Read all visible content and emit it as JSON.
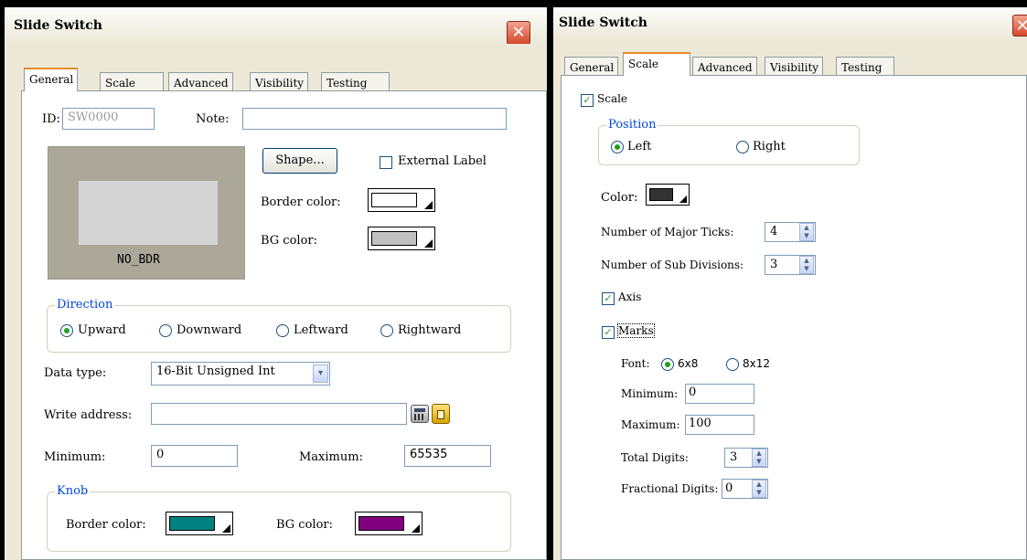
{
  "left": {
    "title": "Slide Switch",
    "tabs": [
      "General",
      "Scale",
      "Advanced",
      "Visibility",
      "Testing"
    ],
    "id_label": "ID:",
    "id_value": "SW0000",
    "note_label": "Note:",
    "note_value": "",
    "preview_label": "NO_BDR",
    "shape_button": "Shape...",
    "external_label": "External Label",
    "border_color_label": "Border color:",
    "bg_color_label": "BG color:",
    "direction_caption": "Direction",
    "directions": [
      "Upward",
      "Downward",
      "Leftward",
      "Rightward"
    ],
    "direction_selected": "Upward",
    "data_type_label": "Data type:",
    "data_type_value": "16-Bit Unsigned Int",
    "write_address_label": "Write address:",
    "write_address_value": "",
    "minimum_label": "Minimum:",
    "minimum_value": "0",
    "maximum_label": "Maximum:",
    "maximum_value": "65535",
    "knob_caption": "Knob",
    "knob_border_label": "Border color:",
    "knob_bg_label": "BG color:",
    "colors": {
      "border": "#ffffff",
      "bg": "#c0c0c0",
      "knob_border": "#008080",
      "knob_bg": "#800080",
      "preview_outer": "#aca899",
      "preview_inner": "#d4d4d4"
    }
  },
  "right": {
    "title": "Slide Switch",
    "tabs": [
      "General",
      "Scale",
      "Advanced",
      "Visibility",
      "Testing"
    ],
    "scale_label": "Scale",
    "scale_checked": true,
    "position_caption": "Position",
    "position_left": "Left",
    "position_right": "Right",
    "position_selected": "Left",
    "color_label": "Color:",
    "color_value": "#333333",
    "major_ticks_label": "Number of Major Ticks:",
    "major_ticks_value": "4",
    "sub_divisions_label": "Number of Sub Divisions:",
    "sub_divisions_value": "3",
    "axis_label": "Axis",
    "axis_checked": true,
    "marks_label": "Marks",
    "marks_checked": true,
    "font_label": "Font:",
    "font_option_1": "6x8",
    "font_option_2": "8x12",
    "font_selected": "6x8",
    "minimum_label": "Minimum:",
    "minimum_value": "0",
    "maximum_label": "Maximum:",
    "maximum_value": "100",
    "total_digits_label": "Total Digits:",
    "total_digits_value": "3",
    "fractional_digits_label": "Fractional Digits:",
    "fractional_digits_value": "0"
  }
}
